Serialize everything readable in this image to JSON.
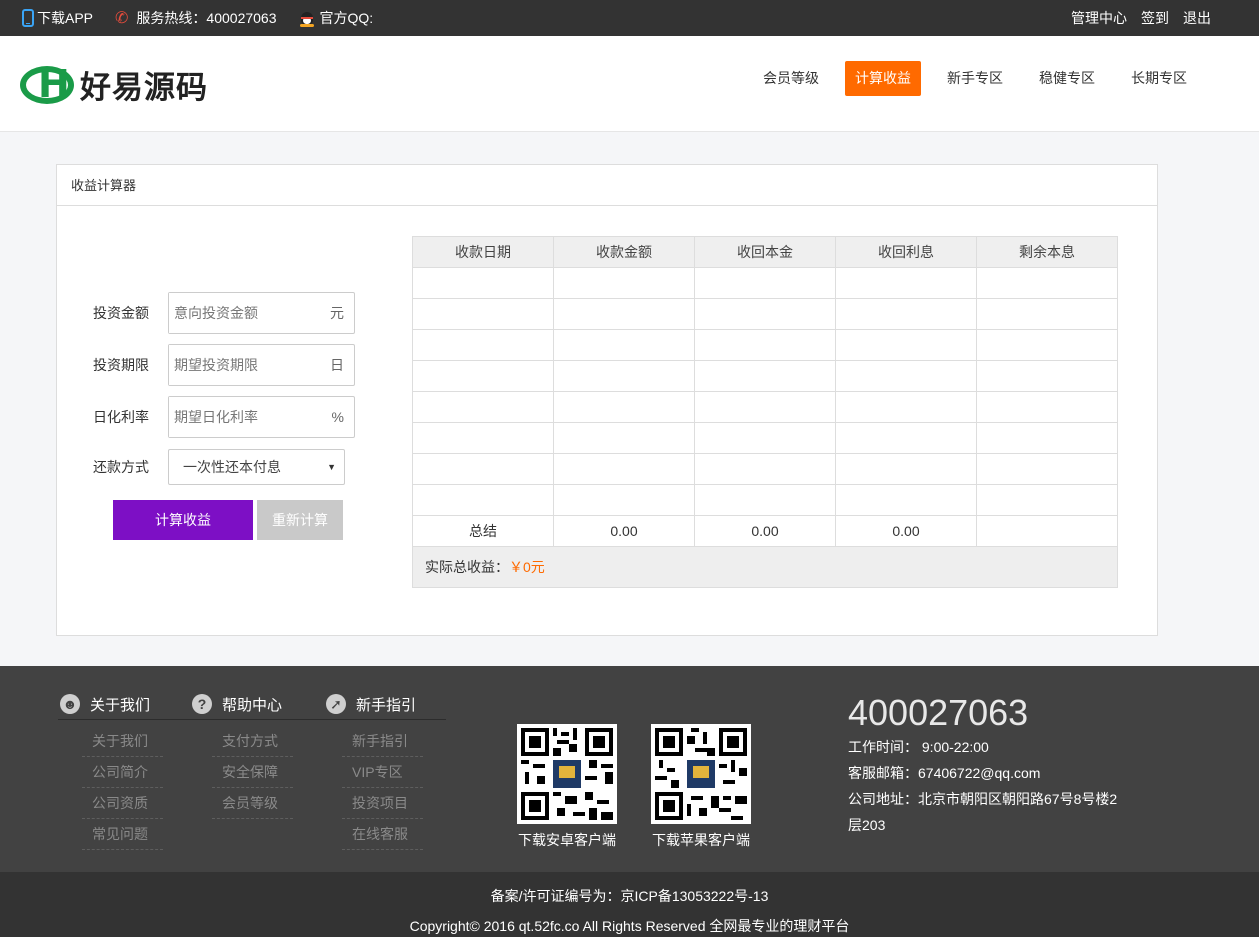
{
  "topbar": {
    "download_app": "下载APP",
    "hotline_label": "服务热线：",
    "hotline_number": "400027063",
    "qq_label": "官方QQ:",
    "links": [
      "管理中心",
      "签到",
      "退出"
    ]
  },
  "header": {
    "logo_text": "好易源码",
    "nav": [
      {
        "label": "会员等级",
        "active": false
      },
      {
        "label": "计算收益",
        "active": true
      },
      {
        "label": "新手专区",
        "active": false
      },
      {
        "label": "稳健专区",
        "active": false
      },
      {
        "label": "长期专区",
        "active": false
      }
    ]
  },
  "calculator": {
    "title": "收益计算器",
    "fields": [
      {
        "label": "投资金额",
        "placeholder": "意向投资金额",
        "unit": "元"
      },
      {
        "label": "投资期限",
        "placeholder": "期望投资期限",
        "unit": "日"
      },
      {
        "label": "日化利率",
        "placeholder": "期望日化利率",
        "unit": "%"
      }
    ],
    "repay": {
      "label": "还款方式",
      "selected": "一次性还本付息"
    },
    "calc_button": "计算收益",
    "reset_button": "重新计算",
    "table": {
      "headers": [
        "收款日期",
        "收款金额",
        "收回本金",
        "收回利息",
        "剩余本息"
      ],
      "total_row": [
        "总结",
        "0.00",
        "0.00",
        "0.00",
        ""
      ]
    },
    "actual_total_label": "实际总收益：",
    "actual_total_value": "￥0元"
  },
  "footer": {
    "columns": [
      {
        "title": "关于我们",
        "icon": "users-icon",
        "items": [
          "关于我们",
          "公司简介",
          "公司资质",
          "常见问题"
        ]
      },
      {
        "title": "帮助中心",
        "icon": "question-icon",
        "items": [
          "支付方式",
          "安全保障",
          "会员等级"
        ]
      },
      {
        "title": "新手指引",
        "icon": "compass-icon",
        "items": [
          "新手指引",
          "VIP专区",
          "投资项目",
          "在线客服"
        ]
      }
    ],
    "qr_android": "下载安卓客户端",
    "qr_ios": "下载苹果客户端",
    "phone": "400027063",
    "work_time_label": "工作时间：",
    "work_time": "9:00-22:00",
    "email_label": "客服邮箱：",
    "email": "67406722@qq.com",
    "address_label": "公司地址：",
    "address_line1": "北京市朝阳区朝阳路67号8号楼2",
    "address_line2": "层203"
  },
  "bottom": {
    "icp": "备案/许可证编号为：京ICP备13053222号-13",
    "copyright": "Copyright© 2016 qt.52fc.co All Rights Reserved 全网最专业的理财平台"
  }
}
